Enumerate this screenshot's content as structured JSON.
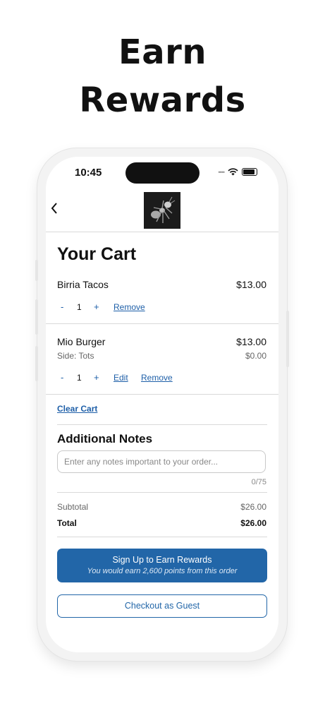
{
  "headline": {
    "line1": "Earn",
    "line2": "Rewards"
  },
  "status_bar": {
    "time": "10:45"
  },
  "cart": {
    "title": "Your Cart",
    "items": [
      {
        "name": "Birria Tacos",
        "price": "$13.00",
        "quantity": "1",
        "minus": "-",
        "plus": "+",
        "remove_label": "Remove"
      },
      {
        "name": "Mio Burger",
        "price": "$13.00",
        "side": "Side: Tots",
        "side_price": "$0.00",
        "quantity": "1",
        "minus": "-",
        "plus": "+",
        "edit_label": "Edit",
        "remove_label": "Remove"
      }
    ],
    "clear_label": "Clear Cart"
  },
  "notes": {
    "title": "Additional Notes",
    "placeholder": "Enter any notes important to your order...",
    "value": "",
    "counter": "0/75"
  },
  "summary": {
    "subtotal_label": "Subtotal",
    "subtotal_value": "$26.00",
    "total_label": "Total",
    "total_value": "$26.00"
  },
  "actions": {
    "rewards_button_title": "Sign Up to Earn Rewards",
    "rewards_button_subtitle": "You would earn 2,600 points from this order",
    "guest_button": "Checkout as Guest"
  },
  "icons": {
    "back": "chevron-left-icon",
    "wifi": "wifi-icon",
    "battery": "battery-icon",
    "logo": "ant-logo"
  },
  "colors": {
    "accent": "#2266a8",
    "text": "#111111",
    "muted": "#666666"
  }
}
